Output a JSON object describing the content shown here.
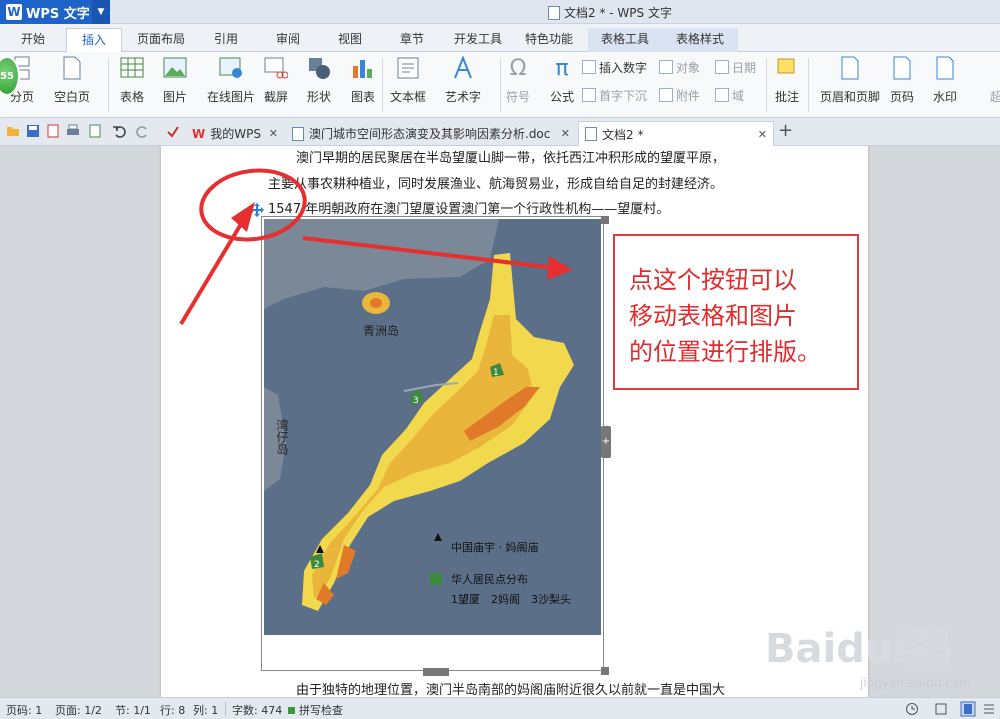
{
  "app": {
    "name": "WPS 文字",
    "doc_title": "文档2 * - WPS 文字"
  },
  "tabs": [
    "开始",
    "插入",
    "页面布局",
    "引用",
    "审阅",
    "视图",
    "章节",
    "开发工具",
    "特色功能",
    "表格工具",
    "表格样式"
  ],
  "active_tab": "插入",
  "ribbon": {
    "badge": "55",
    "page_break": "分页",
    "blank_page": "空白页",
    "table": "表格",
    "picture": "图片",
    "online_picture": "在线图片",
    "screenshot": "截屏",
    "shapes": "形状",
    "chart": "图表",
    "textbox": "文本框",
    "wordart": "艺术字",
    "symbol": "符号",
    "formula": "公式",
    "insert_number": "插入数字",
    "dropcap": "首字下沉",
    "object": "对象",
    "attachment": "附件",
    "date": "日期",
    "field": "域",
    "comment": "批注",
    "header_footer": "页眉和页脚",
    "page_number": "页码",
    "watermark": "水印",
    "overflow": "超"
  },
  "doc_tabs": [
    {
      "label": "我的WPS"
    },
    {
      "label": "澳门城市空间形态演变及其影响因素分析.doc"
    },
    {
      "label": "文档2 *"
    }
  ],
  "document": {
    "line1": "澳门早期的居民聚居在半岛望厦山脚一带，依托西江冲积形成的望厦平原，",
    "line2": "主要从事农耕种植业，同时发展渔业、航海贸易业，形成自给自足的封建经济。",
    "line3": "1547 年明朝政府在澳门望厦设置澳门第一个行政性机构——望厦村。",
    "line_bottom": "由于独特的地理位置，澳门半岛南部的妈阁庙附近很久以前就一直是中国大"
  },
  "map": {
    "label_qingzhou": "青洲岛",
    "label_wanzai": "湾仔岛",
    "legend_temple": "中国庙宇 · 妈阁庙",
    "legend_settlement": "华人居民点分布",
    "legend_items": "1望厦　2妈阁　3沙梨头",
    "marker_1": "1",
    "marker_2": "2",
    "marker_3": "3"
  },
  "callout": {
    "line1": "点这个按钮可以",
    "line2": "移动表格和图片",
    "line3": "的位置进行排版。"
  },
  "watermark": {
    "text": "Baidu经验",
    "sub": "jingyan.baidu.com"
  },
  "status": {
    "page": "页码: 1",
    "pages": "页面: 1/2",
    "section": "节: 1/1",
    "row": "行: 8",
    "col": "列: 1",
    "words": "字数: 474",
    "spell": "拼写检查"
  },
  "colors": {
    "accent": "#1e64c8",
    "callout": "#e02c2c",
    "map_sea": "#5b6f88",
    "map_land": "#f2d84c"
  }
}
